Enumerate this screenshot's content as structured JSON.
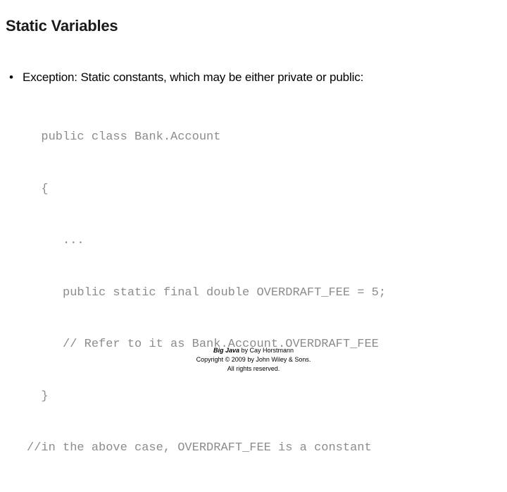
{
  "slide": {
    "title": "Static Variables",
    "bullet": {
      "marker": "•",
      "text": "Exception: Static constants, which may be either private or public:"
    },
    "code": {
      "language": "java",
      "lines": [
        "  public class Bank.Account",
        "  {",
        "     ...",
        "     public static final double OVERDRAFT_FEE = 5;",
        "     // Refer to it as Bank.Account.OVERDRAFT_FEE",
        "  }",
        "//in the above case, OVERDRAFT_FEE is a constant"
      ]
    },
    "footer": {
      "book_title": "Big Java",
      "byline": " by Cay Horstmann",
      "copyright": "Copyright © 2009 by John Wiley & Sons.",
      "rights": "All rights reserved."
    }
  },
  "colors": {
    "background": "#ffffff",
    "title_text": "#1a1a1a",
    "body_text": "#000000",
    "code_text": "#8c8c8c",
    "footer_text": "#000000"
  }
}
